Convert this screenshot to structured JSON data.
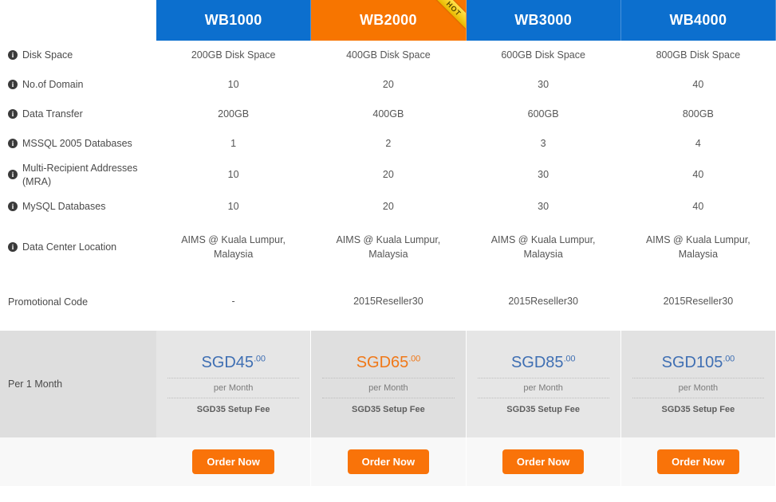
{
  "plans": [
    {
      "name": "WB1000",
      "featured": false,
      "hot_badge": ""
    },
    {
      "name": "WB2000",
      "featured": true,
      "hot_badge": "HOT"
    },
    {
      "name": "WB3000",
      "featured": false,
      "hot_badge": ""
    },
    {
      "name": "WB4000",
      "featured": false,
      "hot_badge": ""
    }
  ],
  "colors": {
    "header_blue": "#0c6fce",
    "header_orange": "#f77500",
    "price_blue": "#3f6fb3",
    "price_orange": "#f07818",
    "button_orange": "#f97309",
    "ribbon_yellow": "#f5cf23"
  },
  "info_icon": "i",
  "rows": [
    {
      "label": "Disk Space",
      "has_info": true,
      "values": [
        "200GB Disk Space",
        "400GB Disk Space",
        "600GB Disk Space",
        "800GB Disk Space"
      ]
    },
    {
      "label": "No.of Domain",
      "has_info": true,
      "values": [
        "10",
        "20",
        "30",
        "40"
      ]
    },
    {
      "label": "Data Transfer",
      "has_info": true,
      "values": [
        "200GB",
        "400GB",
        "600GB",
        "800GB"
      ]
    },
    {
      "label": "MSSQL 2005 Databases",
      "has_info": true,
      "values": [
        "1",
        "2",
        "3",
        "4"
      ]
    },
    {
      "label": "Multi-Recipient Addresses (MRA)",
      "has_info": true,
      "values": [
        "10",
        "20",
        "30",
        "40"
      ]
    },
    {
      "label": "MySQL Databases",
      "has_info": true,
      "values": [
        "10",
        "20",
        "30",
        "40"
      ]
    },
    {
      "label": "Data Center Location",
      "has_info": true,
      "values": [
        "AIMS @ Kuala Lumpur, Malaysia",
        "AIMS @ Kuala Lumpur, Malaysia",
        "AIMS @ Kuala Lumpur, Malaysia",
        "AIMS @ Kuala Lumpur, Malaysia"
      ]
    },
    {
      "label": "Promotional Code",
      "has_info": false,
      "values": [
        "-",
        "2015Reseller30",
        "2015Reseller30",
        "2015Reseller30"
      ]
    }
  ],
  "price_row": {
    "label": "Per 1 Month",
    "per_text": "per Month",
    "setup_text": "SGD35 Setup Fee",
    "cents": ".00",
    "prices": [
      "SGD45",
      "SGD65",
      "SGD85",
      "SGD105"
    ]
  },
  "order": {
    "label": "Order Now"
  }
}
